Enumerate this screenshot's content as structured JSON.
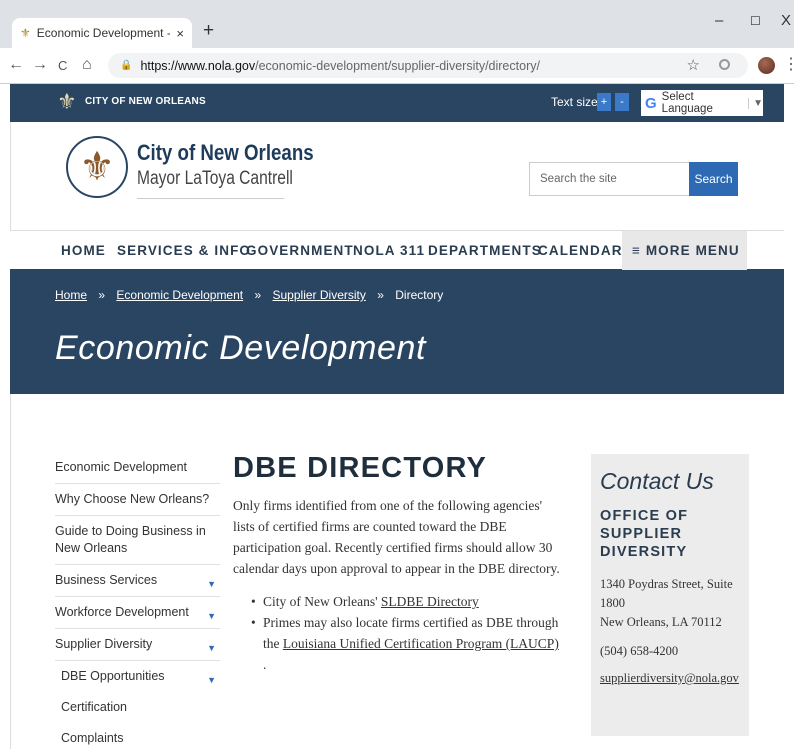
{
  "browser": {
    "tab_title": "Economic Development - Suppli",
    "tab_close": "×",
    "new_tab": "+",
    "win_min": "–",
    "win_max": "☐",
    "win_close": "X",
    "back": "←",
    "forward": "→",
    "reload": "C",
    "home": "⌂",
    "url_host": "https://www.nola.gov",
    "url_path": "/economic-development/supplier-diversity/directory/",
    "star": "☆",
    "menu": "⋮"
  },
  "topbar": {
    "name": "CITY OF NEW ORLEANS",
    "text_size_label": "Text size",
    "text_size_plus": "+",
    "text_size_minus": "-",
    "language_g": "G",
    "language_label": "Select Language",
    "language_caret": "▼"
  },
  "header": {
    "title": "City of New Orleans",
    "subtitle": "Mayor LaToya Cantrell",
    "search_placeholder": "Search the site",
    "search_button": "Search"
  },
  "nav": {
    "items": [
      "HOME",
      "SERVICES & INFO",
      "GOVERNMENT",
      "NOLA 311",
      "DEPARTMENTS",
      "CALENDAR"
    ],
    "more": "≡ MORE MENU"
  },
  "breadcrumb": {
    "items": [
      "Home",
      "Economic Development",
      "Supplier Diversity",
      "Directory"
    ],
    "separator": "»"
  },
  "banner_title": "Economic Development",
  "sidebar": {
    "items": [
      {
        "label": "Economic Development"
      },
      {
        "label": "Why Choose New Orleans?"
      },
      {
        "label": "Guide to Doing Business in New Orleans"
      },
      {
        "label": "Business Services",
        "caret": "▼"
      },
      {
        "label": "Workforce Development",
        "caret": "▼"
      },
      {
        "label": "Supplier Diversity",
        "caret": "▼"
      },
      {
        "label": "DBE Opportunities",
        "caret": "▼"
      },
      {
        "label": "Certification"
      },
      {
        "label": "Complaints"
      }
    ]
  },
  "main": {
    "heading": "DBE DIRECTORY",
    "intro": "Only firms identified from one of the following agencies' lists of certified firms are counted toward the DBE participation goal. Recently certified firms should allow 30 calendar days upon approval to appear in the DBE directory.",
    "bullet1_text": "City of New Orleans' ",
    "bullet1_link": "SLDBE Directory",
    "bullet2_text": "Primes may also locate firms certified as DBE through the ",
    "bullet2_link": "Louisiana Unified Certification Program (LAUCP)",
    "bullet2_end": " ."
  },
  "contact": {
    "title": "Contact Us",
    "office": "OFFICE OF SUPPLIER DIVERSITY",
    "address1": "1340 Poydras Street, Suite 1800",
    "address2": "New Orleans, LA 70112",
    "phone": "(504) 658-4200",
    "email": "supplierdiversity@nola.gov"
  }
}
